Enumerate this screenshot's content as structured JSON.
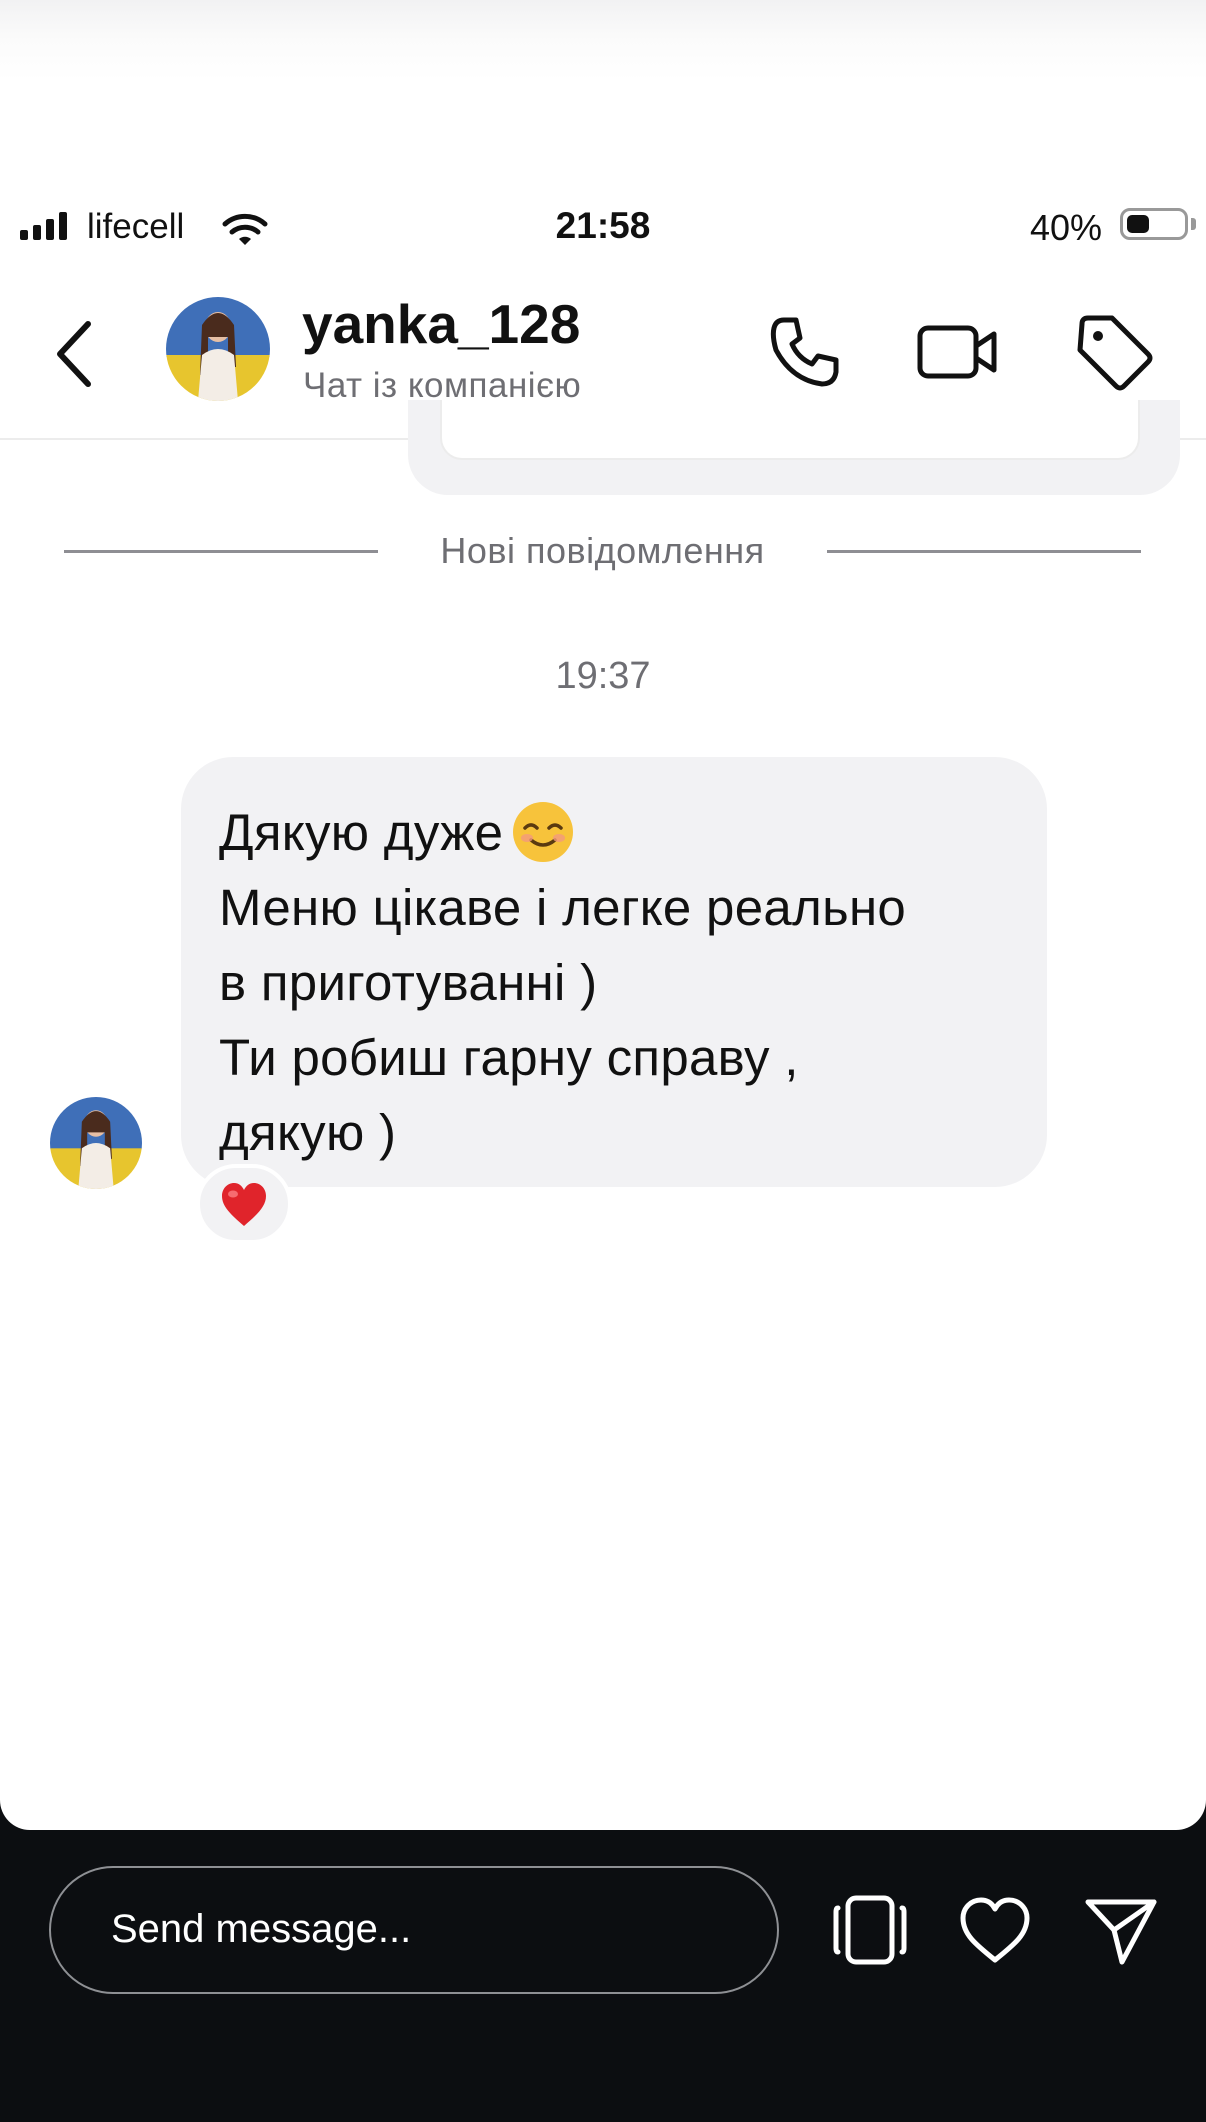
{
  "status_bar": {
    "carrier": "lifecell",
    "time": "21:58",
    "battery_percent": "40%",
    "battery_level": 0.4
  },
  "header": {
    "username": "yanka_128",
    "subtitle": "Чат із компанією",
    "icons": [
      "chevron-left-icon",
      "phone-icon",
      "video-camera-icon",
      "tag-icon"
    ]
  },
  "chat": {
    "divider_label": "Нові повідомлення",
    "timestamp": "19:37",
    "message": {
      "lines": [
        "Дякую дуже",
        "Меню цікаве і легке реально",
        "в приготуванні )",
        "Ти робиш гарну справу ,",
        "дякую )"
      ],
      "emoji": "smiling-face-icon",
      "reaction": "red-heart-icon"
    }
  },
  "composer": {
    "placeholder": "Send message...",
    "icons": [
      "device-frame-icon",
      "heart-icon",
      "send-icon"
    ]
  },
  "colors": {
    "bubble": "#f2f2f4",
    "bottom_bar": "#0c0e11",
    "muted_text": "#6e6e73",
    "heart": "#e0242b"
  }
}
